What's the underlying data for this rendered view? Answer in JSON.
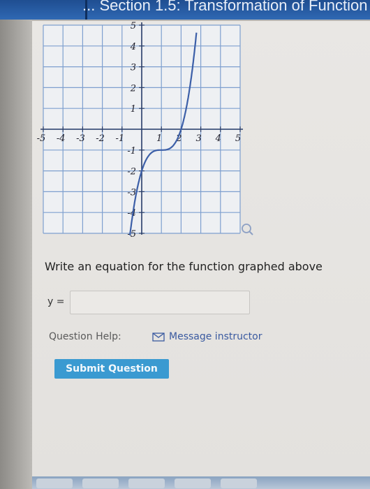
{
  "window": {
    "title": "... Section 1.5: Transformation of Function"
  },
  "graph": {
    "x_ticks": [
      "-5",
      "-4",
      "-3",
      "-2",
      "-1",
      "1",
      "2",
      "3",
      "4",
      "5"
    ],
    "y_ticks": [
      "5",
      "4",
      "3",
      "2",
      "1",
      "-1",
      "-2",
      "-3",
      "-4",
      "-5"
    ],
    "grid_color": "#7e9fcf",
    "curve_color": "#3c5fa8",
    "axis_color": "#2b3f6a",
    "zoom_icon": "magnifier-icon"
  },
  "question": {
    "prompt": "Write an equation for the function graphed above",
    "answer_label": "y =",
    "answer_value": ""
  },
  "help": {
    "label": "Question Help:",
    "link_icon": "envelope-icon",
    "link_text": "Message instructor"
  },
  "submit": {
    "label": "Submit Question",
    "color": "#3a9ad1"
  }
}
